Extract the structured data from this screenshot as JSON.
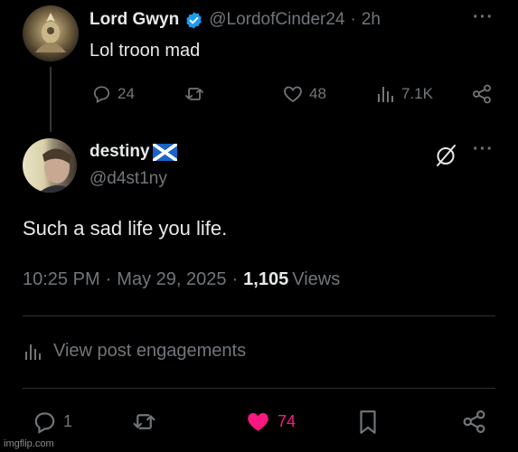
{
  "reply_to": {
    "name": "Lord Gwyn",
    "handle": "@LordofCinder24",
    "separator": "·",
    "time": "2h",
    "text": "Lol troon mad",
    "actions": {
      "replies": "24",
      "likes": "48",
      "views": "7.1K"
    },
    "verified": true
  },
  "post": {
    "name": "destiny",
    "handle": "@d4st1ny",
    "flag": "scotland-flag",
    "text": "Such a sad life you life.",
    "time": "10:25 PM",
    "dot1": "·",
    "date": "May 29, 2025",
    "dot2": "·",
    "views_count": "1,105",
    "views_label": "Views",
    "engagements_label": "View post engagements",
    "actions": {
      "replies": "1",
      "likes": "74"
    },
    "liked": true
  },
  "more_label": "···",
  "watermark": "imgflip.com",
  "colors": {
    "background": "#000000",
    "text": "#e7e9ea",
    "muted": "#71767b",
    "verified": "#1d9bf0",
    "like_active": "#f91880",
    "divider": "#2f3336"
  }
}
